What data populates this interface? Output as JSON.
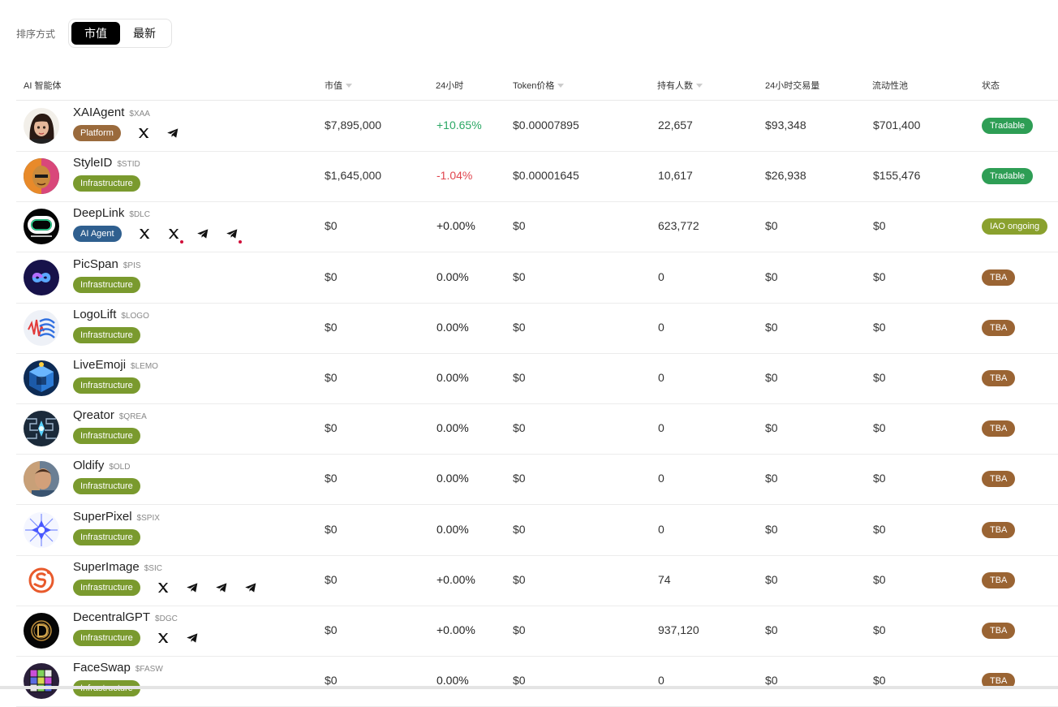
{
  "sort": {
    "label": "排序方式",
    "options": [
      "市值",
      "最新"
    ],
    "active": 0
  },
  "columns": {
    "agent": "AI 智能体",
    "market_cap": "市值",
    "change_24h": "24小时",
    "token_price": "Token价格",
    "holders": "持有人数",
    "volume_24h": "24小时交易量",
    "liquidity": "流动性池",
    "status": "状态"
  },
  "colors": {
    "platform": "#9a6a3c",
    "infrastructure": "#7a9a2e",
    "ai_agent": "#2f5f8f",
    "tradable": "#2e9e55",
    "iao_ongoing": "#8aa12e",
    "tba": "#9a6433",
    "positive": "#2aa764",
    "negative": "#e0454e"
  },
  "rows": [
    {
      "name": "XAIAgent",
      "ticker": "$XAA",
      "category": "Platform",
      "cat_key": "platform",
      "avatar": "anime-girl-avatar",
      "socials": [
        "x",
        "telegram"
      ],
      "alerts": [
        false,
        false
      ],
      "market_cap": "$7,895,000",
      "change": "+10.65%",
      "change_kind": "pos",
      "price": "$0.00007895",
      "holders": "22,657",
      "volume": "$93,348",
      "liquidity": "$701,400",
      "status": "Tradable",
      "status_key": "tradable"
    },
    {
      "name": "StyleID",
      "ticker": "$STID",
      "category": "Infrastructure",
      "cat_key": "infrastructure",
      "avatar": "styled-face-avatar",
      "socials": [],
      "alerts": [],
      "market_cap": "$1,645,000",
      "change": "-1.04%",
      "change_kind": "neg",
      "price": "$0.00001645",
      "holders": "10,617",
      "volume": "$26,938",
      "liquidity": "$155,476",
      "status": "Tradable",
      "status_key": "tradable"
    },
    {
      "name": "DeepLink",
      "ticker": "$DLC",
      "category": "AI Agent",
      "cat_key": "ai_agent",
      "avatar": "deeplink-logo-avatar",
      "socials": [
        "x",
        "x",
        "telegram",
        "telegram"
      ],
      "alerts": [
        false,
        true,
        false,
        true
      ],
      "market_cap": "$0",
      "change": "+0.00%",
      "change_kind": "flat",
      "price": "$0",
      "holders": "623,772",
      "volume": "$0",
      "liquidity": "$0",
      "status": "IAO ongoing",
      "status_key": "iao_ongoing"
    },
    {
      "name": "PicSpan",
      "ticker": "$PIS",
      "category": "Infrastructure",
      "cat_key": "infrastructure",
      "avatar": "infinity-logo-avatar",
      "socials": [],
      "alerts": [],
      "market_cap": "$0",
      "change": "0.00%",
      "change_kind": "flat",
      "price": "$0",
      "holders": "0",
      "volume": "$0",
      "liquidity": "$0",
      "status": "TBA",
      "status_key": "tba"
    },
    {
      "name": "LogoLift",
      "ticker": "$LOGO",
      "category": "Infrastructure",
      "cat_key": "infrastructure",
      "avatar": "wave-logo-avatar",
      "socials": [],
      "alerts": [],
      "market_cap": "$0",
      "change": "0.00%",
      "change_kind": "flat",
      "price": "$0",
      "holders": "0",
      "volume": "$0",
      "liquidity": "$0",
      "status": "TBA",
      "status_key": "tba"
    },
    {
      "name": "LiveEmoji",
      "ticker": "$LEMO",
      "category": "Infrastructure",
      "cat_key": "infrastructure",
      "avatar": "cube-avatar",
      "socials": [],
      "alerts": [],
      "market_cap": "$0",
      "change": "0.00%",
      "change_kind": "flat",
      "price": "$0",
      "holders": "0",
      "volume": "$0",
      "liquidity": "$0",
      "status": "TBA",
      "status_key": "tba"
    },
    {
      "name": "Qreator",
      "ticker": "$QREA",
      "category": "Infrastructure",
      "cat_key": "infrastructure",
      "avatar": "circuit-avatar",
      "socials": [],
      "alerts": [],
      "market_cap": "$0",
      "change": "0.00%",
      "change_kind": "flat",
      "price": "$0",
      "holders": "0",
      "volume": "$0",
      "liquidity": "$0",
      "status": "TBA",
      "status_key": "tba"
    },
    {
      "name": "Oldify",
      "ticker": "$OLD",
      "category": "Infrastructure",
      "cat_key": "infrastructure",
      "avatar": "portrait-avatar",
      "socials": [],
      "alerts": [],
      "market_cap": "$0",
      "change": "0.00%",
      "change_kind": "flat",
      "price": "$0",
      "holders": "0",
      "volume": "$0",
      "liquidity": "$0",
      "status": "TBA",
      "status_key": "tba"
    },
    {
      "name": "SuperPixel",
      "ticker": "$SPIX",
      "category": "Infrastructure",
      "cat_key": "infrastructure",
      "avatar": "star-burst-avatar",
      "socials": [],
      "alerts": [],
      "market_cap": "$0",
      "change": "0.00%",
      "change_kind": "flat",
      "price": "$0",
      "holders": "0",
      "volume": "$0",
      "liquidity": "$0",
      "status": "TBA",
      "status_key": "tba"
    },
    {
      "name": "SuperImage",
      "ticker": "$SIC",
      "category": "Infrastructure",
      "cat_key": "infrastructure",
      "avatar": "s-logo-avatar",
      "socials": [
        "x",
        "telegram",
        "telegram",
        "telegram"
      ],
      "alerts": [
        false,
        false,
        false,
        false
      ],
      "market_cap": "$0",
      "change": "+0.00%",
      "change_kind": "flat",
      "price": "$0",
      "holders": "74",
      "volume": "$0",
      "liquidity": "$0",
      "status": "TBA",
      "status_key": "tba"
    },
    {
      "name": "DecentralGPT",
      "ticker": "$DGC",
      "category": "Infrastructure",
      "cat_key": "infrastructure",
      "avatar": "d-coin-avatar",
      "socials": [
        "x",
        "telegram"
      ],
      "alerts": [
        false,
        false
      ],
      "market_cap": "$0",
      "change": "+0.00%",
      "change_kind": "flat",
      "price": "$0",
      "holders": "937,120",
      "volume": "$0",
      "liquidity": "$0",
      "status": "TBA",
      "status_key": "tba"
    },
    {
      "name": "FaceSwap",
      "ticker": "$FASW",
      "category": "Infrastructure",
      "cat_key": "infrastructure",
      "avatar": "rubik-avatar",
      "socials": [],
      "alerts": [],
      "market_cap": "$0",
      "change": "0.00%",
      "change_kind": "flat",
      "price": "$0",
      "holders": "0",
      "volume": "$0",
      "liquidity": "$0",
      "status": "TBA",
      "status_key": "tba"
    }
  ]
}
